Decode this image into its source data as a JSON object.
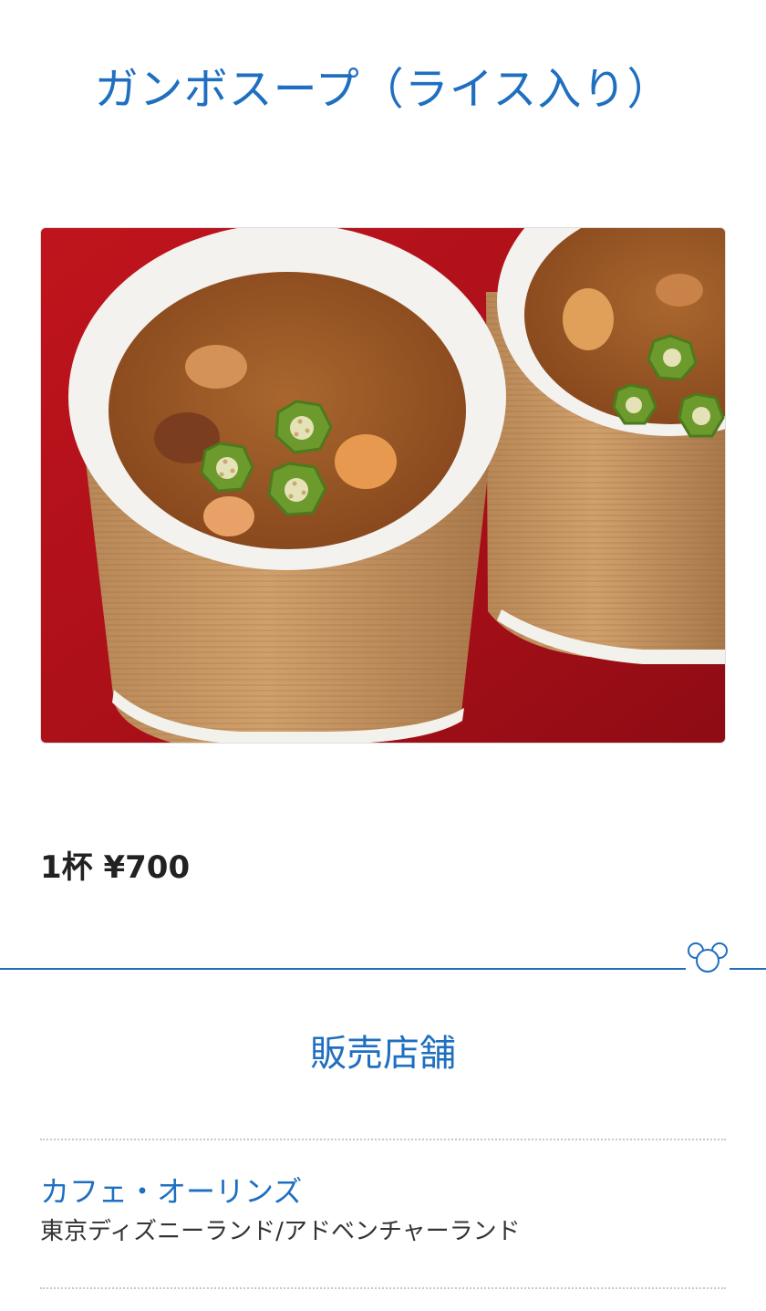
{
  "product": {
    "title": "ガンボスープ（ライス入り）",
    "price": "1杯 ¥700"
  },
  "stores_section": {
    "heading": "販売店舗",
    "stores": [
      {
        "name": "カフェ・オーリンズ",
        "location": "東京ディズニーランド/アドベンチャーランド"
      }
    ]
  },
  "colors": {
    "accent": "#1f6fc0",
    "text": "#222222",
    "divider_dots": "#c8c8c8",
    "photo_background": "#b3121b"
  },
  "icons": {
    "divider_mark": "mickey-head-icon"
  }
}
